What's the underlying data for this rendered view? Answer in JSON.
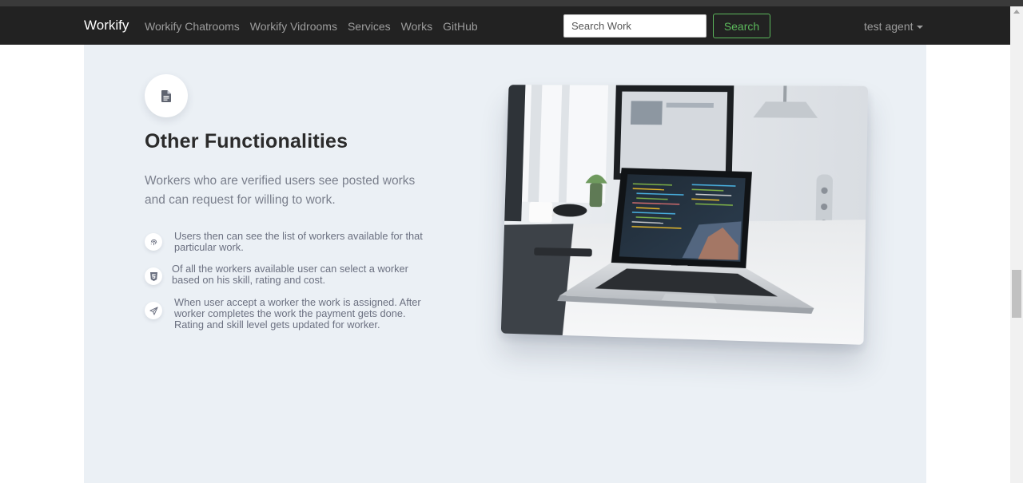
{
  "navbar": {
    "brand": "Workify",
    "links": [
      "Workify Chatrooms",
      "Workify Vidrooms",
      "Services",
      "Works",
      "GitHub"
    ],
    "search_placeholder": "Search Work",
    "search_button": "Search",
    "user_name": "test agent"
  },
  "section": {
    "icon": "document-icon",
    "title": "Other Functionalities",
    "lead": "Workers who are verified users see posted works and can request for willing to work.",
    "features": [
      {
        "icon": "fingerprint-icon",
        "text": "Users then can see the list of workers available for that particular work."
      },
      {
        "icon": "html5-shield-icon",
        "text": "Of all the workers available user can select a worker based on his skill, rating and cost."
      },
      {
        "icon": "paper-plane-icon",
        "text": "When user accept a worker the work is assigned. After worker completes the work the payment gets done. Rating and skill level gets updated for worker."
      }
    ],
    "image": "laptop-on-desk-photo"
  },
  "colors": {
    "navbar_bg": "#222222",
    "nav_text": "#9d9d9d",
    "search_button": "#5cb85c",
    "section_bg": "#ebf0f5",
    "title": "#2b2b2b"
  }
}
